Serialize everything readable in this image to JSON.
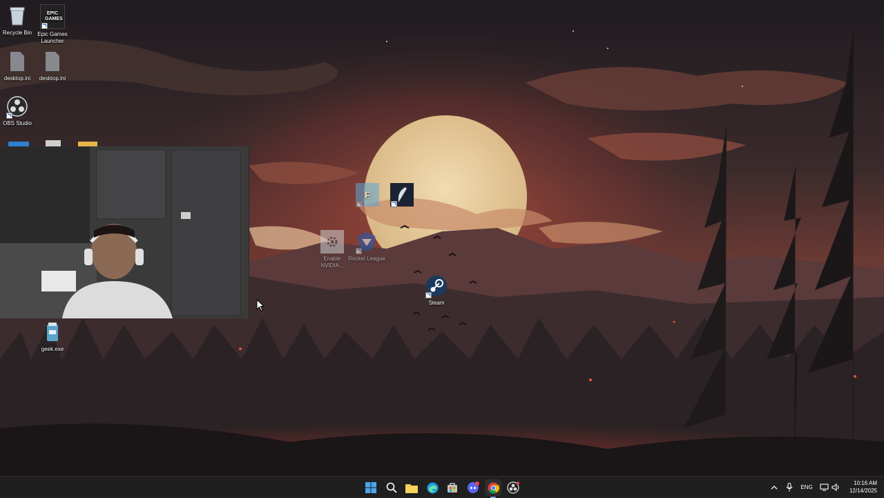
{
  "desktop_icons": {
    "recycle_bin": "Recycle Bin",
    "epic_games": "Epic Games Launcher",
    "epic_logo_text": "EPIC GAMES",
    "desktop_ini_1": "desktop.ini",
    "desktop_ini_2": "desktop.ini",
    "obs": "OBS Studio",
    "enable_nvidia": "Enable NVIDIA...",
    "rocket_league": "Rocket League",
    "steam": "Steam",
    "geek": "geek.exe"
  },
  "taskbar": {
    "apps": [
      "start-icon",
      "search-icon",
      "file-explorer-icon",
      "edge-icon",
      "store-icon",
      "discord-icon",
      "chrome-icon",
      "obs-icon"
    ],
    "active_app": "chrome-icon"
  },
  "tray": {
    "language": "ENG",
    "time": "10:16 AM",
    "date": "12/14/2025"
  },
  "colors": {
    "taskbar_bg": "#1f1f20",
    "sky_top": "#221c22",
    "sun": "#e6d0a2",
    "glow": "#c4423a"
  }
}
